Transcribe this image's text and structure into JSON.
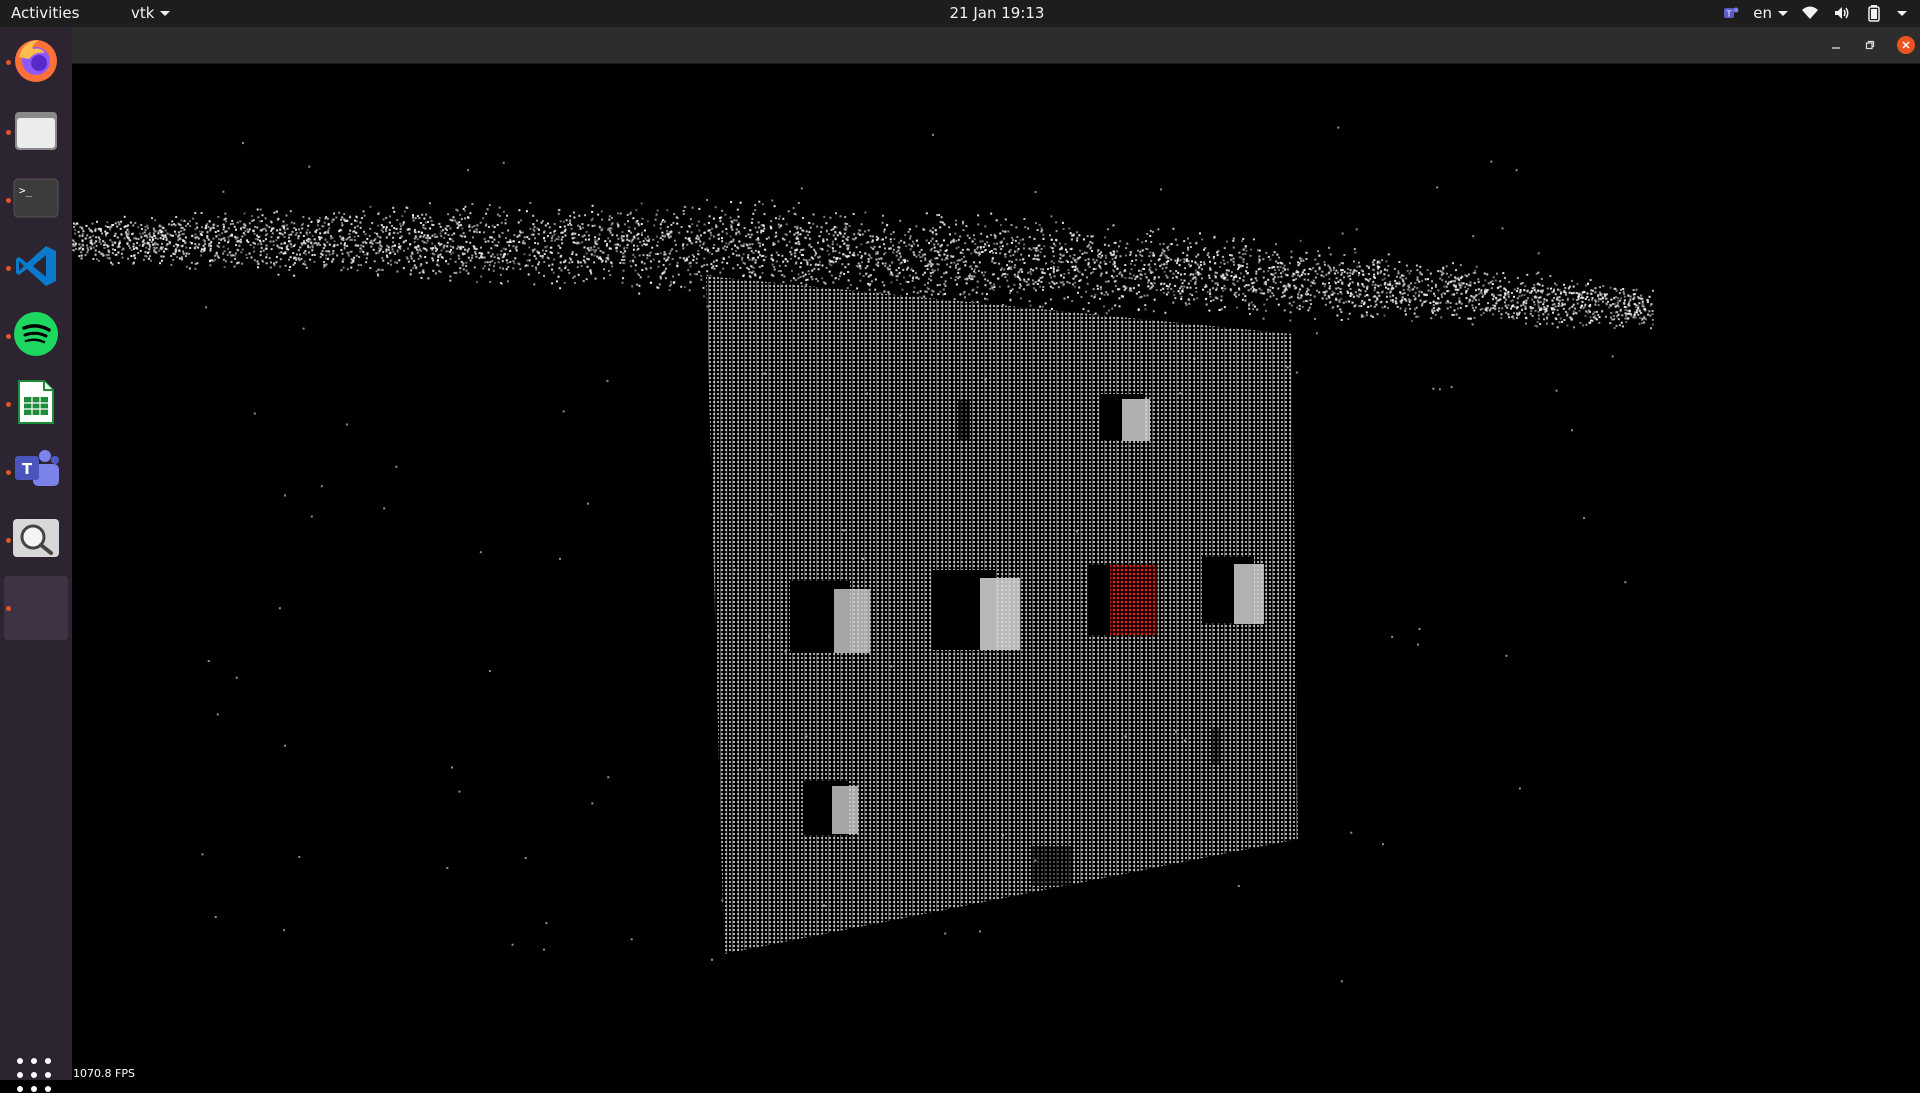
{
  "topbar": {
    "activities_label": "Activities",
    "app_menu_label": "vtk",
    "clock": "21 Jan  19:13",
    "language": "en"
  },
  "dock": {
    "items": [
      {
        "name": "firefox",
        "running": true
      },
      {
        "name": "files",
        "running": true
      },
      {
        "name": "terminal",
        "running": true
      },
      {
        "name": "vscode",
        "running": true
      },
      {
        "name": "spotify",
        "running": true
      },
      {
        "name": "libreoffice-calc",
        "running": true
      },
      {
        "name": "teams",
        "running": true
      },
      {
        "name": "image-viewer",
        "running": true
      },
      {
        "name": "vtk-window",
        "running": true,
        "active": true
      }
    ]
  },
  "window": {
    "title": "",
    "fps_label": "1070.8 FPS"
  },
  "colors": {
    "accent": "#e95420",
    "dock_bg": "#2c2430",
    "topbar_bg": "#1d1d1d",
    "point_cloud": "#d8d8d8",
    "highlight": "#d02020"
  }
}
